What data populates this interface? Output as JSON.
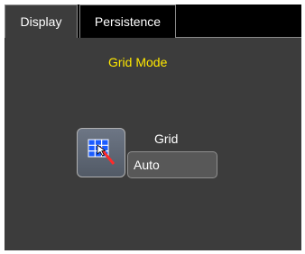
{
  "tabs": [
    {
      "label": "Display",
      "active": true
    },
    {
      "label": "Persistence",
      "active": false
    }
  ],
  "main": {
    "group_title": "Grid Mode",
    "grid": {
      "label": "Grid",
      "value": "Auto",
      "icon": "grid-mode-icon"
    }
  },
  "colors": {
    "panel_background": "#3c3c3c",
    "group_title": "#ffe800",
    "field_background": "#585858"
  }
}
